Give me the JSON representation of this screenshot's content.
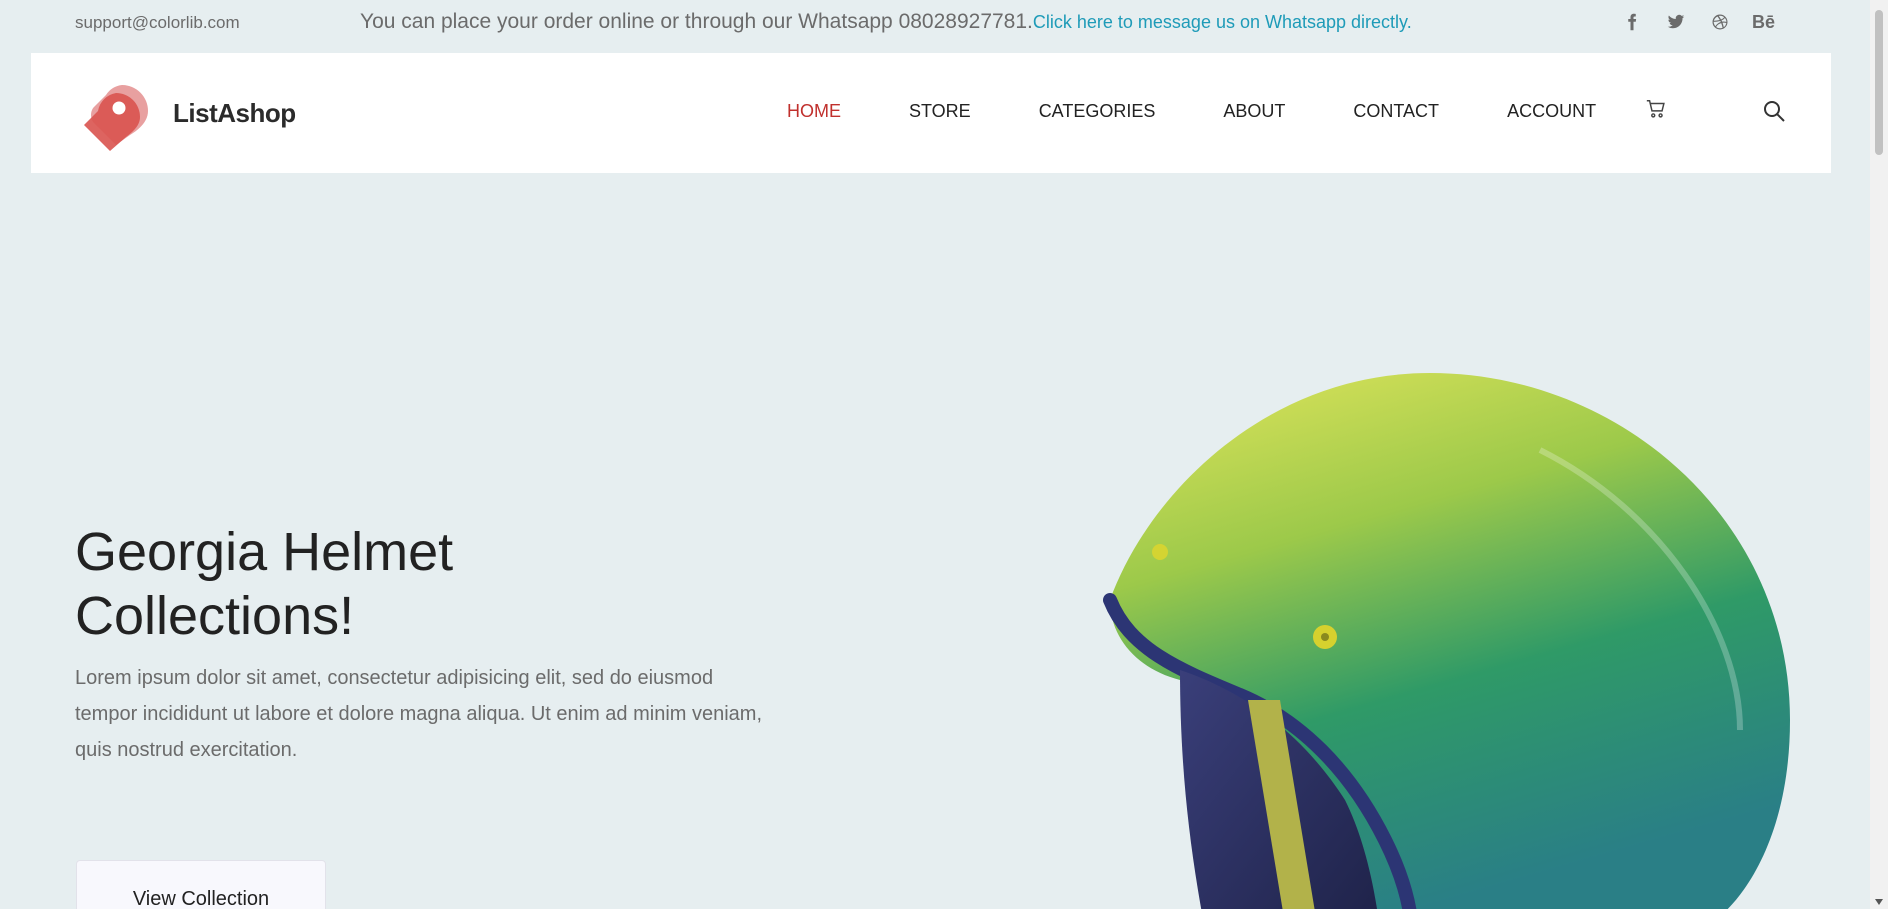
{
  "topbar": {
    "email": "support@colorlib.com",
    "notice": "You can place your order online or through our Whatsapp 08028927781.",
    "whatsapp_link": "Click here to message us on Whatsapp directly.",
    "social": [
      "facebook-icon",
      "twitter-icon",
      "dribbble-icon",
      "behance-icon"
    ],
    "behance_label": "Bē"
  },
  "header": {
    "brand": "ListAshop",
    "nav": [
      {
        "label": "HOME",
        "active": true
      },
      {
        "label": "STORE",
        "active": false
      },
      {
        "label": "CATEGORIES",
        "active": false
      },
      {
        "label": "ABOUT",
        "active": false
      },
      {
        "label": "CONTACT",
        "active": false
      },
      {
        "label": "ACCOUNT",
        "active": false
      }
    ]
  },
  "hero": {
    "title": "Georgia Helmet Collections!",
    "text": "Lorem ipsum dolor sit amet, consectetur adipisicing elit, sed do eiusmod tempor incididunt ut labore et dolore magna aliqua. Ut enim ad minim veniam, quis nostrud exercitation.",
    "button": "View Collection"
  },
  "colors": {
    "accent": "#c0302d",
    "link": "#1e9bb8",
    "background": "#e6eef0",
    "logo_red": "#d9534f"
  }
}
